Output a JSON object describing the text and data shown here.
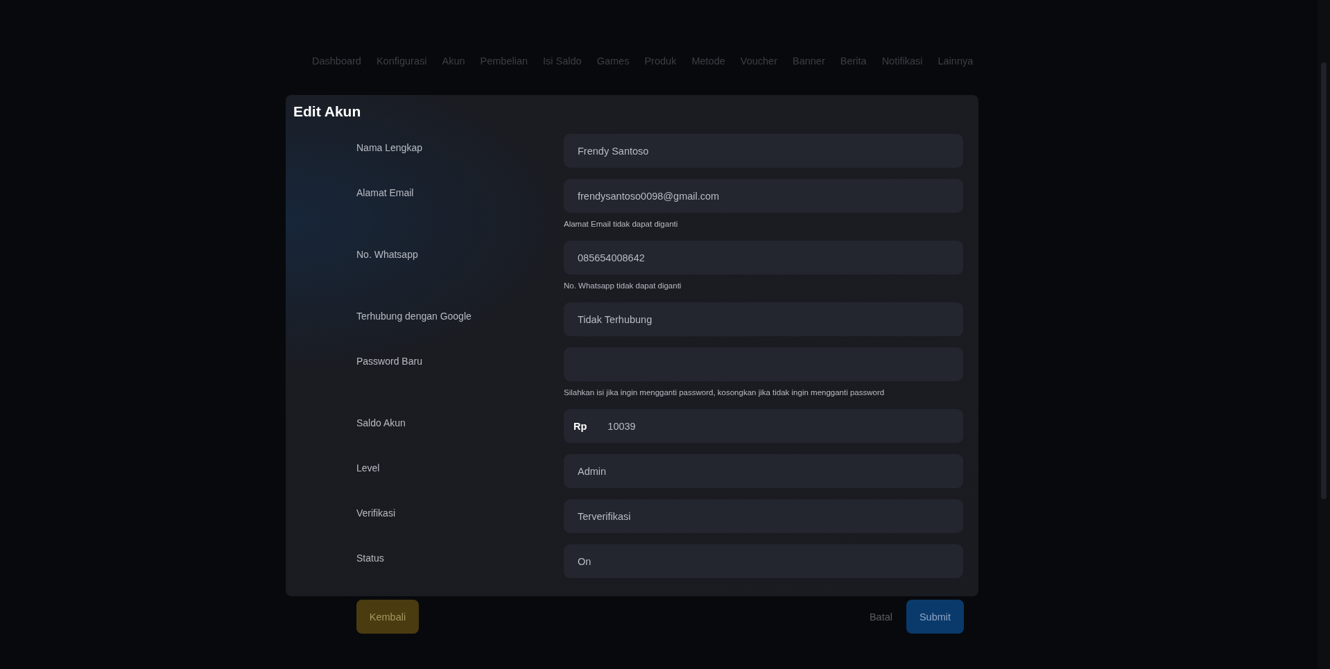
{
  "nav": [
    {
      "label": "Dashboard"
    },
    {
      "label": "Konfigurasi"
    },
    {
      "label": "Akun"
    },
    {
      "label": "Pembelian"
    },
    {
      "label": "Isi Saldo"
    },
    {
      "label": "Games"
    },
    {
      "label": "Produk"
    },
    {
      "label": "Metode"
    },
    {
      "label": "Voucher"
    },
    {
      "label": "Banner"
    },
    {
      "label": "Berita"
    },
    {
      "label": "Notifikasi"
    },
    {
      "label": "Lainnya"
    }
  ],
  "title": "Edit Akun",
  "fields": [
    {
      "label": "Nama Lengkap",
      "value": "Frendy Santoso"
    },
    {
      "label": "Alamat Email",
      "value": "frendysantoso0098@gmail.com",
      "hint": "Alamat Email tidak dapat diganti"
    },
    {
      "label": "No. Whatsapp",
      "value": "085654008642",
      "hint": "No. Whatsapp tidak dapat diganti"
    },
    {
      "label": "Terhubung dengan Google",
      "value": "Tidak Terhubung"
    },
    {
      "label": "Password Baru",
      "hint": "Silahkan isi jika ingin mengganti password, kosongkan jika tidak ingin mengganti password"
    },
    {
      "label": "Saldo Akun",
      "prefix": "Rp",
      "value": "10039"
    },
    {
      "label": "Level",
      "value": "Admin"
    },
    {
      "label": "Verifikasi",
      "value": "Terverifikasi"
    },
    {
      "label": "Status",
      "value": "On"
    }
  ],
  "buttons": [
    {
      "kind": "back",
      "label": "Kembali"
    },
    {
      "kind": "cancel",
      "label": "Batal"
    },
    {
      "kind": "submit",
      "label": "Submit"
    }
  ]
}
